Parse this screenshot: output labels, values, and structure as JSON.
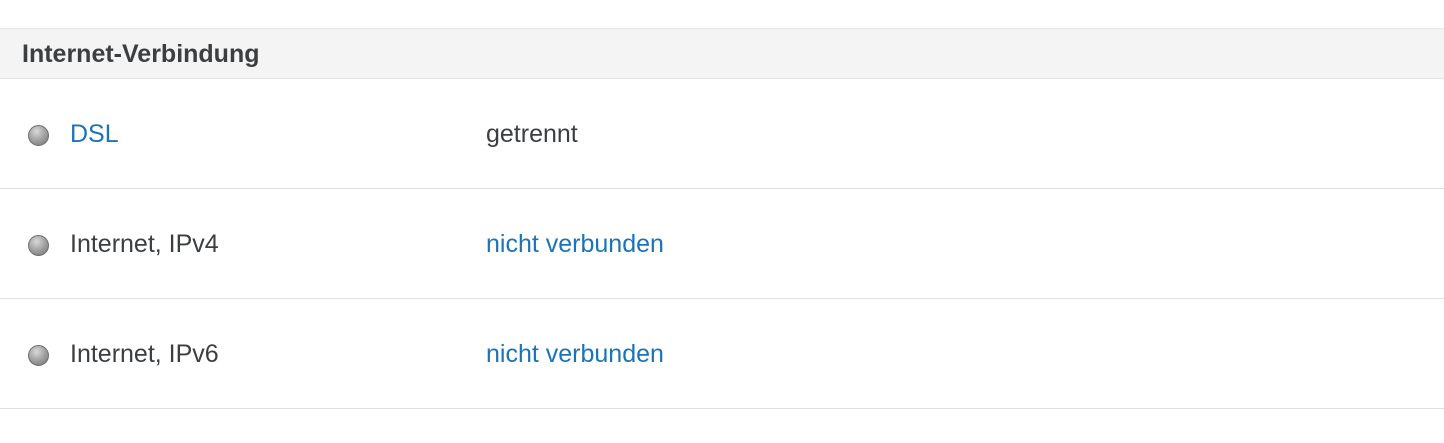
{
  "section": {
    "title": "Internet-Verbindung"
  },
  "rows": [
    {
      "label": "DSL",
      "value": "getrennt",
      "status_icon": "led-grey-icon"
    },
    {
      "label": "Internet, IPv4",
      "value": "nicht verbunden",
      "status_icon": "led-grey-icon"
    },
    {
      "label": "Internet, IPv6",
      "value": "nicht verbunden",
      "status_icon": "led-grey-icon"
    }
  ],
  "colors": {
    "link": "#1c74b8",
    "text": "#3c3f41",
    "header_background": "#f3f4f3",
    "led_off": "#a6a6a6"
  }
}
